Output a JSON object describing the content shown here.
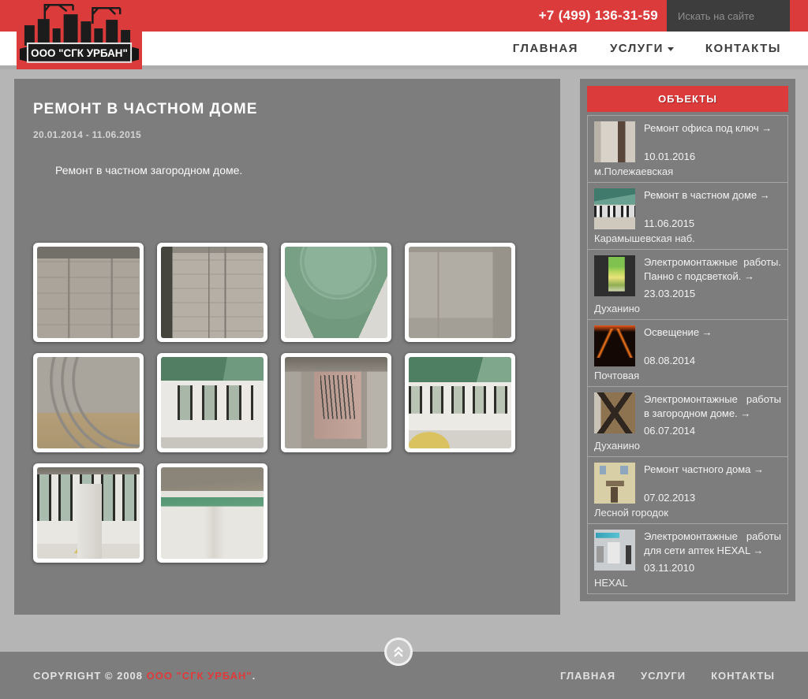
{
  "header": {
    "phone": "+7 (499) 136-31-59",
    "search_placeholder": "Искать на сайте",
    "logo_text": "ООО \"СГК УРБАН\"",
    "nav": [
      {
        "label": "ГЛАВНАЯ"
      },
      {
        "label": "УСЛУГИ",
        "has_dropdown": true
      },
      {
        "label": "КОНТАКТЫ"
      }
    ]
  },
  "main": {
    "title": "РЕМОНТ В ЧАСТНОМ ДОМЕ",
    "date_range": "20.01.2014 - 11.06.2015",
    "description": "Ремонт в частном загородном доме.",
    "gallery": [
      {
        "name": "block-wall-with-conduits",
        "style": "g1"
      },
      {
        "name": "wall-with-hanging-wires",
        "style": "g2"
      },
      {
        "name": "green-ceiling-circle",
        "style": "g3"
      },
      {
        "name": "plastered-room-with-conduits",
        "style": "g4"
      },
      {
        "name": "conduit-bundle-near-floor",
        "style": "g5"
      },
      {
        "name": "room-windows-green-ceiling",
        "style": "g6"
      },
      {
        "name": "shaft-with-hanging-cables",
        "style": "g7"
      },
      {
        "name": "bay-window-room",
        "style": "g8"
      },
      {
        "name": "windows-and-white-column",
        "style": "g9"
      },
      {
        "name": "green-drywall-band-on-wall",
        "style": "g10"
      }
    ]
  },
  "sidebar": {
    "title": "ОБЪЕКТЫ",
    "items": [
      {
        "title": "Ремонт офиса под ключ →",
        "date": "10.01.2016",
        "location": "м.Полежаевская",
        "style": "s1"
      },
      {
        "title": "Ремонт в частном доме →",
        "date": "11.06.2015",
        "location": "Карамышевская наб.",
        "style": "s2"
      },
      {
        "title": "Электромонтажные работы. Панно с подсветкой. →",
        "date": "23.03.2015",
        "location": "Духанино",
        "style": "s3"
      },
      {
        "title": "Освещение →",
        "date": "08.08.2014",
        "location": "Почтовая",
        "style": "s4"
      },
      {
        "title": "Электромонтажные работы в загородном доме. →",
        "date": "06.07.2014",
        "location": "Духанино",
        "style": "s5"
      },
      {
        "title": "Ремонт частного дома →",
        "date": "07.02.2013",
        "location": "Лесной городок",
        "style": "s6"
      },
      {
        "title": "Электромонтажные работы для сети аптек HEXAL →",
        "date": "03.11.2010",
        "location": "HEXAL",
        "style": "s7"
      }
    ]
  },
  "footer": {
    "copyright_prefix": "COPYRIGHT © 2008 ",
    "copyright_brand": "ООО \"СГК УРБАН\"",
    "copyright_suffix": ".",
    "nav": [
      "ГЛАВНАЯ",
      "УСЛУГИ",
      "КОНТАКТЫ"
    ]
  },
  "colors": {
    "accent_red": "#dc3b3b",
    "panel_gray": "#7d7d7d",
    "page_bg": "#b5b5b5",
    "search_bg": "#3d3d3d"
  }
}
